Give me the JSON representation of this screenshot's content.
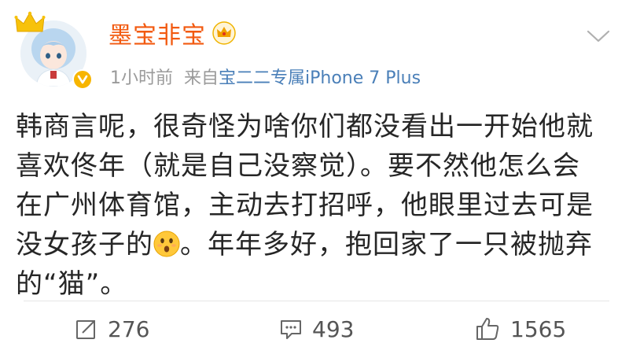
{
  "post": {
    "username": "墨宝非宝",
    "time": "1小时前",
    "source_prefix": "来自",
    "source_device": "宝二二专属iPhone 7 Plus",
    "text_part1": "韩商言呢，很奇怪为啥你们都没看出一开始他就\n喜欢佟年（就是自己没察觉）。要不然他怎么会\n在广州体育馆，主动去打招呼，他眼里过去可是\n没女孩子的",
    "text_part2": "。年年多好，抱回家了一只被抛弃\n的“猫”。"
  },
  "actions": {
    "repost_count": "276",
    "comment_count": "493",
    "like_count": "1565"
  },
  "icons": {
    "avatar_crown": "crown-icon",
    "vip": "vip-crown-icon",
    "verified": "verified-badge-icon",
    "dropdown": "chevron-down-icon",
    "emoji": "surprised-face-emoji",
    "repost": "repost-icon",
    "comment": "comment-icon",
    "like": "thumbs-up-icon"
  },
  "colors": {
    "username": "#f25a10",
    "source_link": "#4a7fb8",
    "meta": "#9a9a9a",
    "vip": "#f7b500"
  }
}
